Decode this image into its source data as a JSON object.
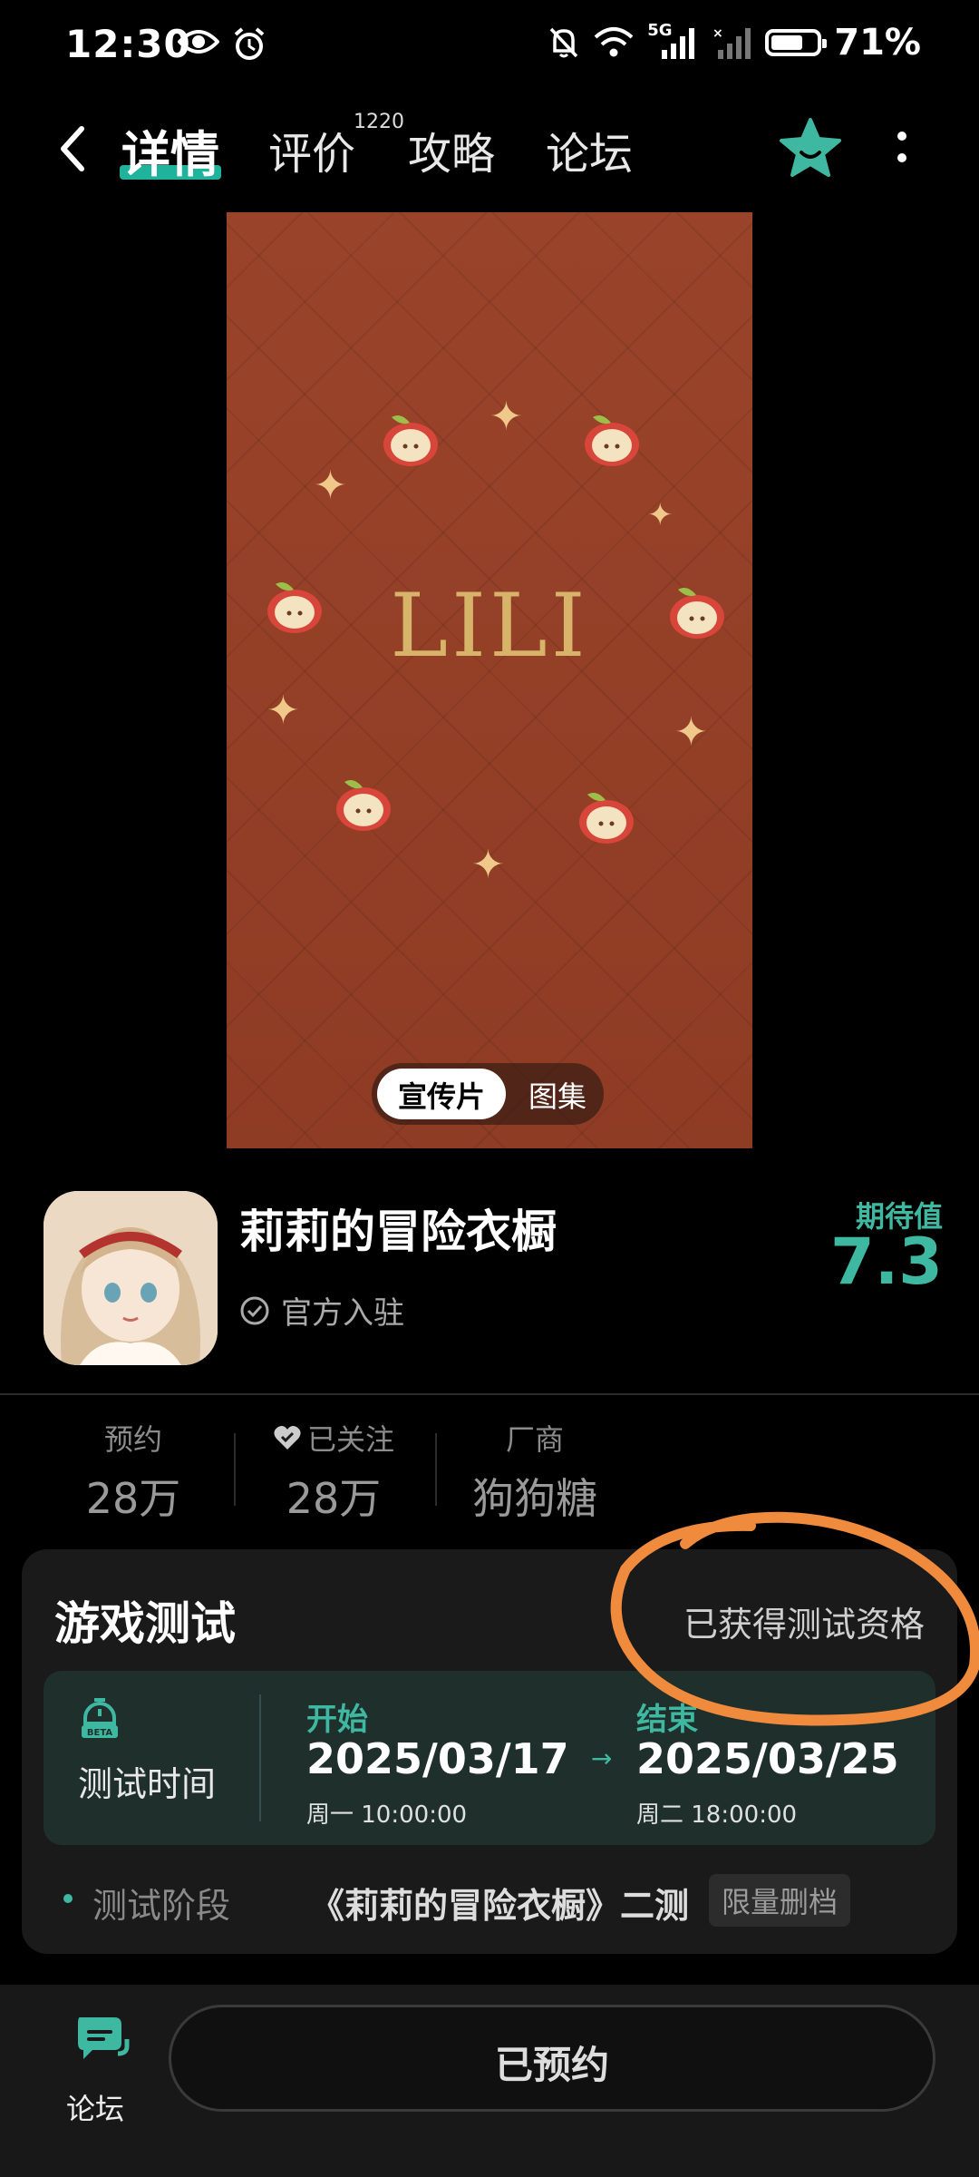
{
  "status_bar": {
    "time": "12:30",
    "network": "5G",
    "battery_text": "71%",
    "battery_level": 0.71
  },
  "nav": {
    "tabs": [
      {
        "label": "详情",
        "active": true
      },
      {
        "label": "评价",
        "badge": "1220"
      },
      {
        "label": "攻略"
      },
      {
        "label": "论坛"
      }
    ]
  },
  "hero": {
    "logo_text": "LILI",
    "toggle": {
      "selected": "宣传片",
      "other": "图集"
    }
  },
  "app": {
    "name": "莉莉的冒险衣橱",
    "official_label": "官方入驻",
    "expect_label": "期待值",
    "expect_value": "7.3"
  },
  "stats": [
    {
      "label": "预约",
      "value": "28万"
    },
    {
      "label": "已关注",
      "value": "28万",
      "icon": "heart-check-icon"
    },
    {
      "label": "厂商",
      "value": "狗狗糖"
    }
  ],
  "test_card": {
    "title": "游戏测试",
    "status": "已获得测试资格",
    "time_label": "测试时间",
    "icon_badge": "BETA",
    "start": {
      "label": "开始",
      "date": "2025/03/17",
      "day": "周一  10:00:00"
    },
    "end": {
      "label": "结束",
      "date": "2025/03/25",
      "day": "周二  18:00:00"
    },
    "stage_label": "测试阶段",
    "stage_value": "《莉莉的冒险衣橱》二测",
    "stage_tag": "限量删档"
  },
  "bottom_bar": {
    "forum_label": "论坛",
    "reserve_label": "已预约"
  },
  "colors": {
    "accent": "#3fb8a2",
    "annotation": "#f08a3c",
    "hero_bg": "#953f27"
  }
}
